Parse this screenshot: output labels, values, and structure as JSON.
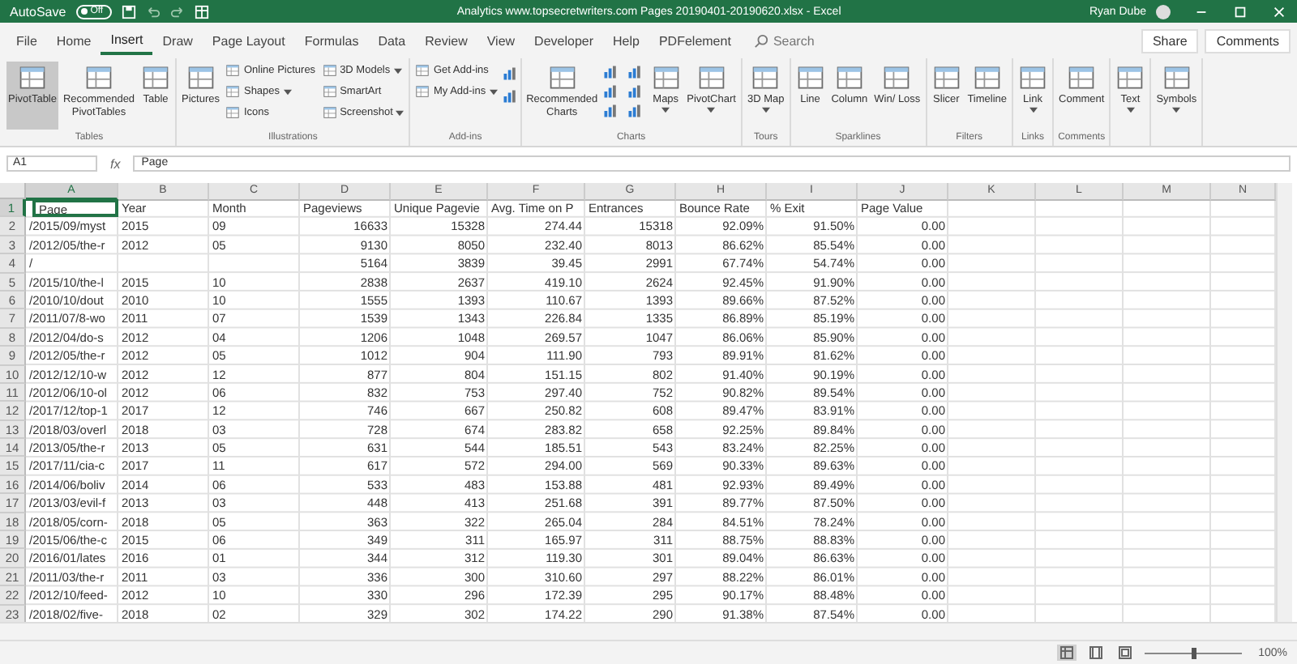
{
  "window": {
    "autosave_label": "AutoSave",
    "autosave_toggle": {
      "label": "Off",
      "on": false
    },
    "title": "Analytics www.topsecretwriters.com Pages 20190401-20190620.xlsx  -  Excel",
    "user": "Ryan Dube"
  },
  "tabs": [
    {
      "label": "File",
      "selected": false
    },
    {
      "label": "Home",
      "selected": false
    },
    {
      "label": "Insert",
      "selected": true
    },
    {
      "label": "Draw",
      "selected": false
    },
    {
      "label": "Page Layout",
      "selected": false
    },
    {
      "label": "Formulas",
      "selected": false
    },
    {
      "label": "Data",
      "selected": false
    },
    {
      "label": "Review",
      "selected": false
    },
    {
      "label": "View",
      "selected": false
    },
    {
      "label": "Developer",
      "selected": false
    },
    {
      "label": "Help",
      "selected": false
    },
    {
      "label": "PDFelement",
      "selected": false
    }
  ],
  "search": {
    "placeholder": "Search"
  },
  "actions": [
    "Share",
    "Comments"
  ],
  "ribbon": {
    "groups": [
      {
        "label": "Tables",
        "items": [
          {
            "kind": "large",
            "label": "PivotTable",
            "menu": false,
            "highlighted": true
          },
          {
            "kind": "large",
            "label": "Recommended PivotTables",
            "menu": false,
            "highlighted": false
          },
          {
            "kind": "large",
            "label": "Table",
            "menu": false,
            "highlighted": false
          }
        ]
      },
      {
        "label": "Illustrations",
        "items": [
          {
            "kind": "large",
            "label": "Pictures",
            "menu": false,
            "highlighted": false
          },
          {
            "kind": "stack",
            "items": [
              {
                "label": "Online Pictures",
                "menu": false
              },
              {
                "label": "Shapes",
                "menu": true
              },
              {
                "label": "Icons",
                "menu": false
              }
            ]
          },
          {
            "kind": "stack",
            "items": [
              {
                "label": "3D Models",
                "menu": true
              },
              {
                "label": "SmartArt",
                "menu": false
              },
              {
                "label": "Screenshot",
                "menu": true
              }
            ]
          }
        ]
      },
      {
        "label": "Add-ins",
        "items": [
          {
            "kind": "stack",
            "items": [
              {
                "label": "Get Add-ins",
                "menu": false
              },
              {
                "label": "My Add-ins",
                "menu": true
              }
            ]
          },
          {
            "kind": "icon_column"
          }
        ]
      },
      {
        "label": "Charts",
        "items": [
          {
            "kind": "large",
            "label": "Recommended Charts",
            "menu": false,
            "highlighted": false
          },
          {
            "kind": "icon_grid"
          },
          {
            "kind": "large",
            "label": "Maps",
            "menu": true,
            "highlighted": false
          },
          {
            "kind": "large",
            "label": "PivotChart",
            "menu": true,
            "highlighted": false
          }
        ]
      },
      {
        "label": "Tours",
        "items": [
          {
            "kind": "large",
            "label": "3D Map",
            "menu": true,
            "highlighted": false
          }
        ]
      },
      {
        "label": "Sparklines",
        "items": [
          {
            "kind": "large",
            "label": "Line",
            "menu": false,
            "highlighted": false
          },
          {
            "kind": "large",
            "label": "Column",
            "menu": false,
            "highlighted": false
          },
          {
            "kind": "large",
            "label": "Win/ Loss",
            "menu": false,
            "highlighted": false
          }
        ]
      },
      {
        "label": "Filters",
        "items": [
          {
            "kind": "large",
            "label": "Slicer",
            "menu": false,
            "highlighted": false
          },
          {
            "kind": "large",
            "label": "Timeline",
            "menu": false,
            "highlighted": false
          }
        ]
      },
      {
        "label": "Links",
        "items": [
          {
            "kind": "large",
            "label": "Link",
            "menu": true,
            "highlighted": false
          }
        ]
      },
      {
        "label": "Comments",
        "items": [
          {
            "kind": "large",
            "label": "Comment",
            "menu": false,
            "highlighted": false
          }
        ]
      },
      {
        "items": [
          {
            "kind": "large",
            "label": "Text",
            "menu": true,
            "highlighted": false
          }
        ]
      },
      {
        "items": [
          {
            "kind": "large",
            "label": "Symbols",
            "menu": true,
            "highlighted": false
          }
        ]
      }
    ]
  },
  "formula_bar": {
    "name_box": "A1",
    "function_label": "fx",
    "content": "Page"
  },
  "sheet": {
    "columns": [
      {
        "letter": "A",
        "selected": true
      },
      {
        "letter": "B",
        "numeric": false,
        "selected": false
      },
      {
        "letter": "C",
        "numeric": false,
        "selected": false
      },
      {
        "letter": "D",
        "numeric": true,
        "selected": false
      },
      {
        "letter": "E",
        "numeric": true,
        "selected": false
      },
      {
        "letter": "F",
        "numeric": true,
        "selected": false
      },
      {
        "letter": "G",
        "numeric": true,
        "selected": false
      },
      {
        "letter": "H",
        "numeric": true,
        "selected": false
      },
      {
        "letter": "I",
        "numeric": true,
        "selected": false
      },
      {
        "letter": "J",
        "numeric": true,
        "selected": false
      },
      {
        "letter": "K",
        "selected": false
      },
      {
        "letter": "L",
        "selected": false
      },
      {
        "letter": "M",
        "selected": false
      },
      {
        "letter": "N",
        "selected": false
      }
    ],
    "rows": [
      {
        "n": "1",
        "selected": true,
        "cells": [
          "Page",
          "Year",
          "Month",
          "Pageviews",
          "Unique Pagevie",
          "Avg. Time on P",
          "Entrances",
          "Bounce Rate",
          "% Exit",
          "Page Value"
        ]
      },
      {
        "n": "2",
        "selected": false,
        "cells": [
          "/2015/09/myst",
          "2015",
          "09",
          "16633",
          "15328",
          "274.44",
          "15318",
          "92.09%",
          "91.50%",
          "0.00"
        ]
      },
      {
        "n": "3",
        "selected": false,
        "cells": [
          "/2012/05/the-r",
          "2012",
          "05",
          "9130",
          "8050",
          "232.40",
          "8013",
          "86.62%",
          "85.54%",
          "0.00"
        ]
      },
      {
        "n": "4",
        "selected": false,
        "cells": [
          "/",
          "",
          "",
          "5164",
          "3839",
          "39.45",
          "2991",
          "67.74%",
          "54.74%",
          "0.00"
        ]
      },
      {
        "n": "5",
        "selected": false,
        "cells": [
          "/2015/10/the-l",
          "2015",
          "10",
          "2838",
          "2637",
          "419.10",
          "2624",
          "92.45%",
          "91.90%",
          "0.00"
        ]
      },
      {
        "n": "6",
        "selected": false,
        "cells": [
          "/2010/10/dout",
          "2010",
          "10",
          "1555",
          "1393",
          "110.67",
          "1393",
          "89.66%",
          "87.52%",
          "0.00"
        ]
      },
      {
        "n": "7",
        "selected": false,
        "cells": [
          "/2011/07/8-wo",
          "2011",
          "07",
          "1539",
          "1343",
          "226.84",
          "1335",
          "86.89%",
          "85.19%",
          "0.00"
        ]
      },
      {
        "n": "8",
        "selected": false,
        "cells": [
          "/2012/04/do-s",
          "2012",
          "04",
          "1206",
          "1048",
          "269.57",
          "1047",
          "86.06%",
          "85.90%",
          "0.00"
        ]
      },
      {
        "n": "9",
        "selected": false,
        "cells": [
          "/2012/05/the-r",
          "2012",
          "05",
          "1012",
          "904",
          "111.90",
          "793",
          "89.91%",
          "81.62%",
          "0.00"
        ]
      },
      {
        "n": "10",
        "selected": false,
        "cells": [
          "/2012/12/10-w",
          "2012",
          "12",
          "877",
          "804",
          "151.15",
          "802",
          "91.40%",
          "90.19%",
          "0.00"
        ]
      },
      {
        "n": "11",
        "selected": false,
        "cells": [
          "/2012/06/10-ol",
          "2012",
          "06",
          "832",
          "753",
          "297.40",
          "752",
          "90.82%",
          "89.54%",
          "0.00"
        ]
      },
      {
        "n": "12",
        "selected": false,
        "cells": [
          "/2017/12/top-1",
          "2017",
          "12",
          "746",
          "667",
          "250.82",
          "608",
          "89.47%",
          "83.91%",
          "0.00"
        ]
      },
      {
        "n": "13",
        "selected": false,
        "cells": [
          "/2018/03/overl",
          "2018",
          "03",
          "728",
          "674",
          "283.82",
          "658",
          "92.25%",
          "89.84%",
          "0.00"
        ]
      },
      {
        "n": "14",
        "selected": false,
        "cells": [
          "/2013/05/the-r",
          "2013",
          "05",
          "631",
          "544",
          "185.51",
          "543",
          "83.24%",
          "82.25%",
          "0.00"
        ]
      },
      {
        "n": "15",
        "selected": false,
        "cells": [
          "/2017/11/cia-c",
          "2017",
          "11",
          "617",
          "572",
          "294.00",
          "569",
          "90.33%",
          "89.63%",
          "0.00"
        ]
      },
      {
        "n": "16",
        "selected": false,
        "cells": [
          "/2014/06/boliv",
          "2014",
          "06",
          "533",
          "483",
          "153.88",
          "481",
          "92.93%",
          "89.49%",
          "0.00"
        ]
      },
      {
        "n": "17",
        "selected": false,
        "cells": [
          "/2013/03/evil-f",
          "2013",
          "03",
          "448",
          "413",
          "251.68",
          "391",
          "89.77%",
          "87.50%",
          "0.00"
        ]
      },
      {
        "n": "18",
        "selected": false,
        "cells": [
          "/2018/05/corn-",
          "2018",
          "05",
          "363",
          "322",
          "265.04",
          "284",
          "84.51%",
          "78.24%",
          "0.00"
        ]
      },
      {
        "n": "19",
        "selected": false,
        "cells": [
          "/2015/06/the-c",
          "2015",
          "06",
          "349",
          "311",
          "165.97",
          "311",
          "88.75%",
          "88.83%",
          "0.00"
        ]
      },
      {
        "n": "20",
        "selected": false,
        "cells": [
          "/2016/01/lates",
          "2016",
          "01",
          "344",
          "312",
          "119.30",
          "301",
          "89.04%",
          "86.63%",
          "0.00"
        ]
      },
      {
        "n": "21",
        "selected": false,
        "cells": [
          "/2011/03/the-r",
          "2011",
          "03",
          "336",
          "300",
          "310.60",
          "297",
          "88.22%",
          "86.01%",
          "0.00"
        ]
      },
      {
        "n": "22",
        "selected": false,
        "cells": [
          "/2012/10/feed-",
          "2012",
          "10",
          "330",
          "296",
          "172.39",
          "295",
          "90.17%",
          "88.48%",
          "0.00"
        ]
      },
      {
        "n": "23",
        "selected": false,
        "cells": [
          "/2018/02/five-",
          "2018",
          "02",
          "329",
          "302",
          "174.22",
          "290",
          "91.38%",
          "87.54%",
          "0.00"
        ]
      }
    ]
  },
  "status_bar": {
    "views": [
      {
        "selected": true
      },
      {
        "selected": false
      },
      {
        "selected": false
      }
    ],
    "zoom_slider": {
      "level": 0.5
    },
    "zoom": "100%"
  }
}
